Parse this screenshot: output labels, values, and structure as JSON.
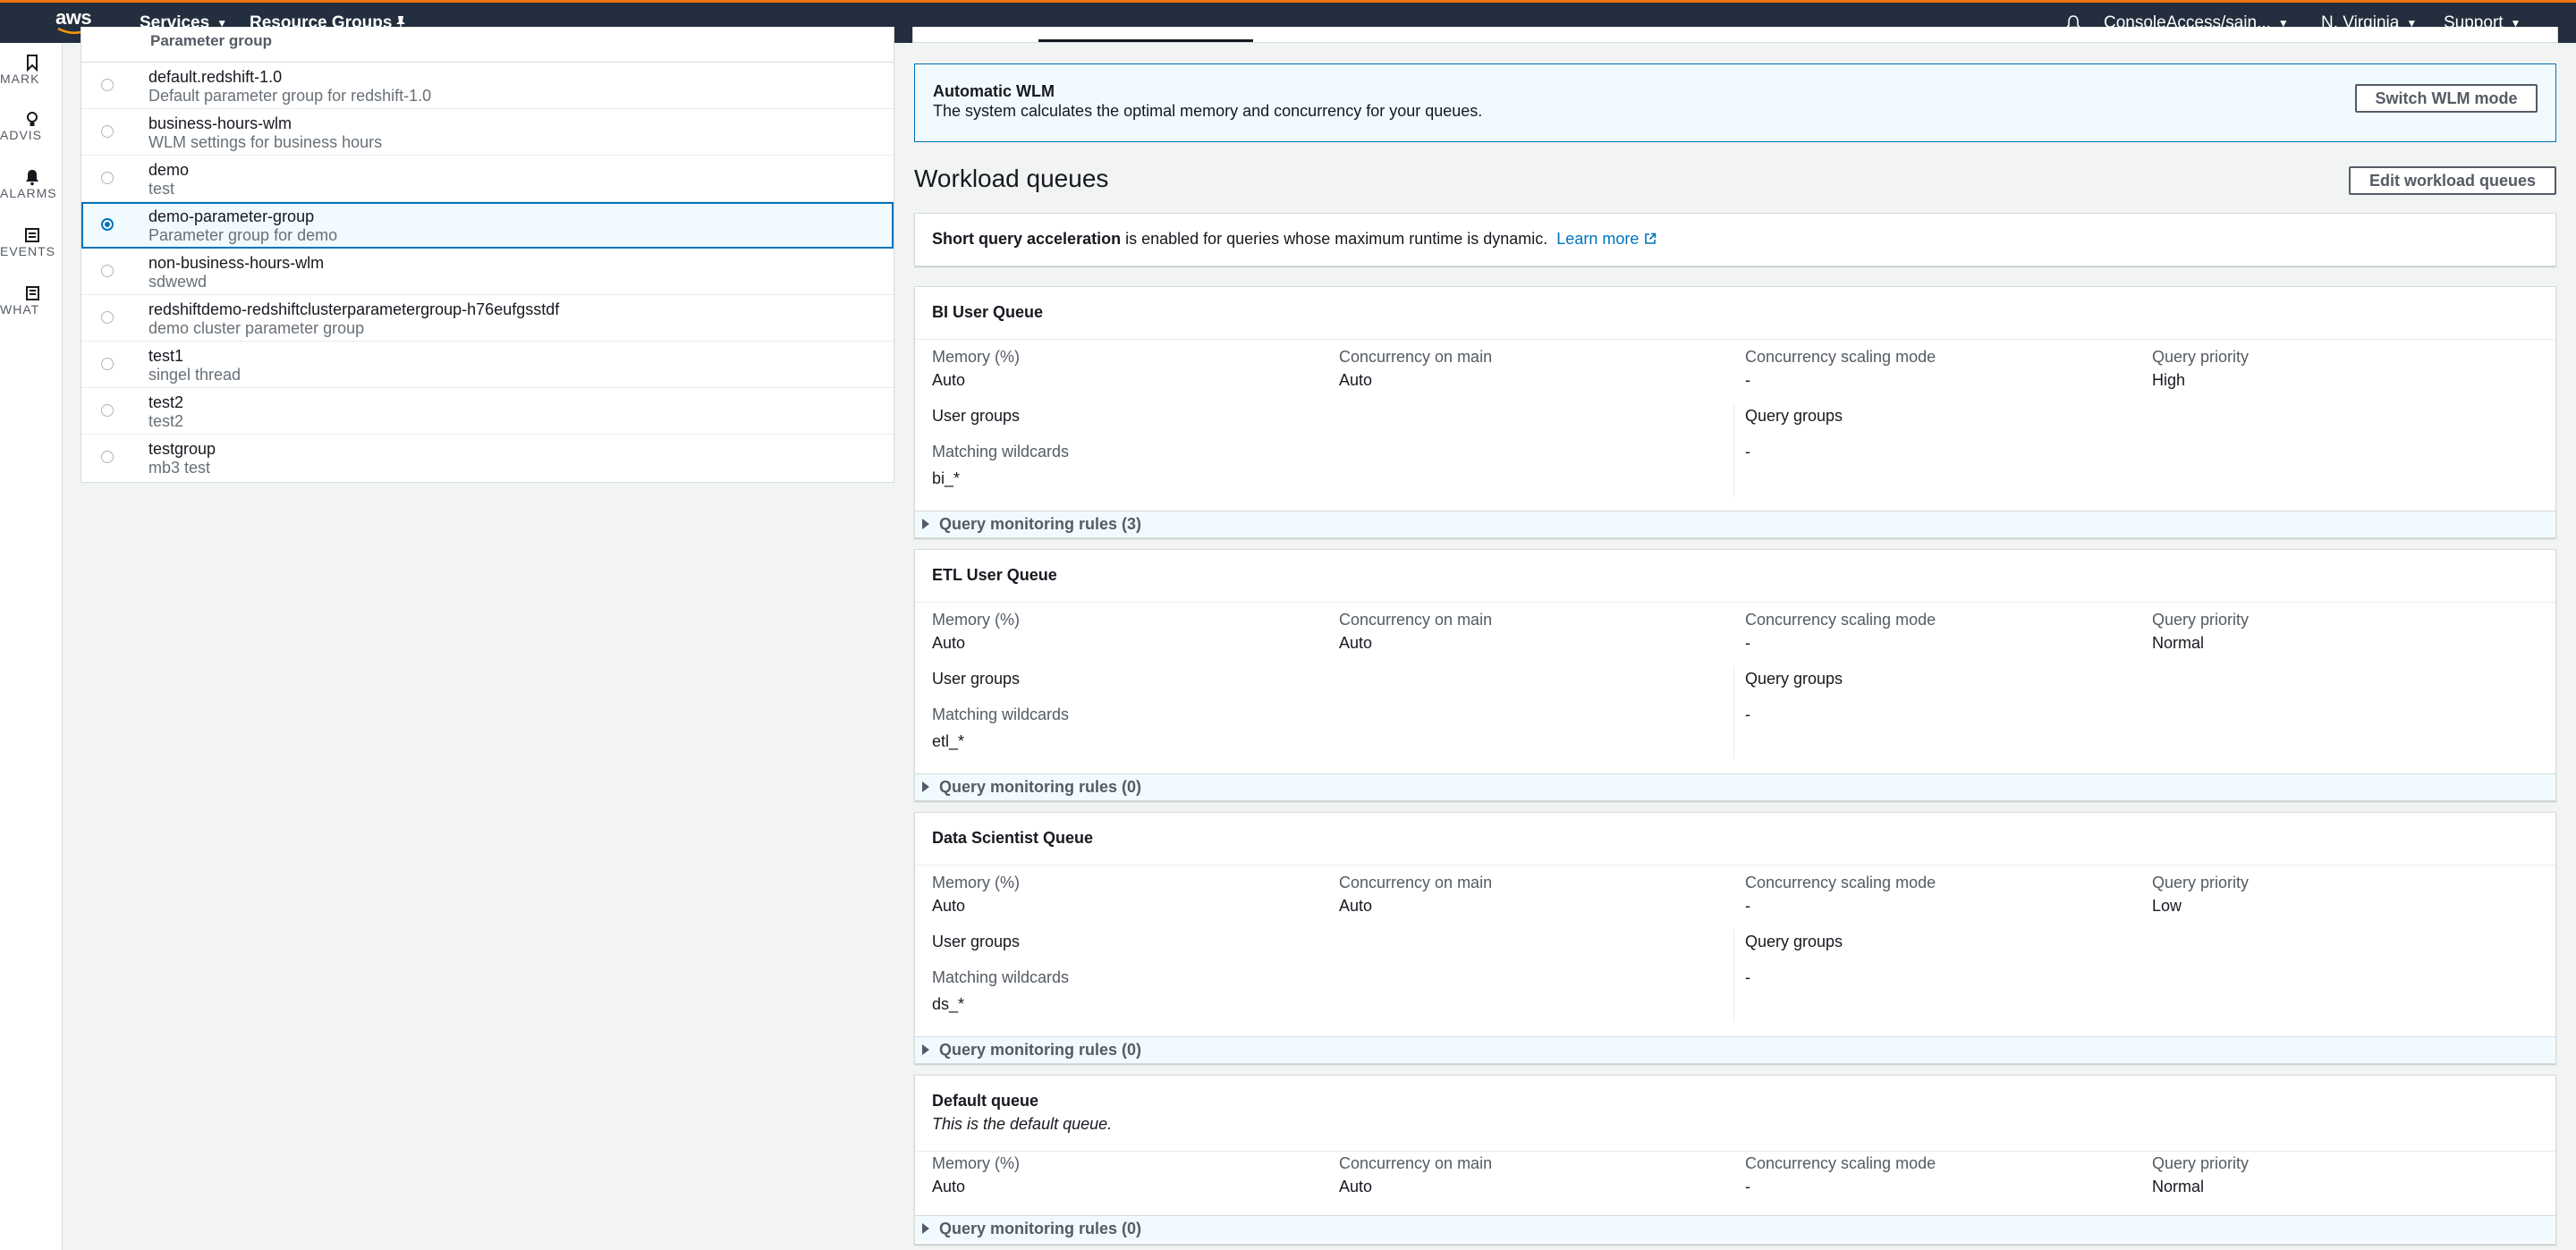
{
  "topnav": {
    "logo": "aws",
    "services_label": "Services",
    "resource_groups_label": "Resource Groups",
    "account_label": "ConsoleAccess/sain...",
    "region_label": "N. Virginia",
    "support_label": "Support",
    "icons": [
      "pin-icon",
      "bell-icon",
      "caret-down-icon"
    ]
  },
  "rail": {
    "items": [
      {
        "label": "MARK",
        "icon": "bookmark-icon"
      },
      {
        "label": "ADVIS",
        "icon": "lightbulb-icon"
      },
      {
        "label": "ALARMS",
        "icon": "bell-icon"
      },
      {
        "label": "EVENTS",
        "icon": "calendar-icon"
      },
      {
        "label": "WHAT",
        "icon": "document-icon"
      }
    ]
  },
  "parameter_groups": {
    "header": "Parameter group",
    "rows": [
      {
        "name": "default.redshift-1.0",
        "desc": "Default parameter group for redshift-1.0"
      },
      {
        "name": "business-hours-wlm",
        "desc": "WLM settings for business hours"
      },
      {
        "name": "demo",
        "desc": "test"
      },
      {
        "name": "demo-parameter-group",
        "desc": "Parameter group for demo"
      },
      {
        "name": "non-business-hours-wlm",
        "desc": "sdwewd"
      },
      {
        "name": "redshiftdemo-redshiftclusterparametergroup-h76eufgsstdf",
        "desc": "demo cluster parameter group"
      },
      {
        "name": "test1",
        "desc": "singel thread"
      },
      {
        "name": "test2",
        "desc": "test2"
      },
      {
        "name": "testgroup",
        "desc": "mb3 test"
      }
    ],
    "selected_index": 3
  },
  "wlm": {
    "title": "Automatic WLM",
    "desc": "The system calculates the optimal memory and concurrency for your queues.",
    "switch_label": "Switch WLM mode"
  },
  "workload": {
    "title": "Workload queues",
    "edit_label": "Edit workload queues",
    "sqa_bold": "Short query acceleration",
    "sqa_rest": " is enabled for queries whose maximum runtime is dynamic.",
    "learn_more": "Learn more"
  },
  "labels": {
    "memory": "Memory (%)",
    "concurrency": "Concurrency on main",
    "scaling": "Concurrency scaling mode",
    "priority": "Query priority",
    "user_groups": "User groups",
    "query_groups": "Query groups",
    "wildcards": "Matching wildcards"
  },
  "queues": [
    {
      "name": "BI User Queue",
      "memory": "Auto",
      "concurrency": "Auto",
      "scaling": "-",
      "priority": "High",
      "user_wildcard": "bi_*",
      "query_wildcard": "-",
      "rules": "Query monitoring rules (3)"
    },
    {
      "name": "ETL User Queue",
      "memory": "Auto",
      "concurrency": "Auto",
      "scaling": "-",
      "priority": "Normal",
      "user_wildcard": "etl_*",
      "query_wildcard": "-",
      "rules": "Query monitoring rules (0)"
    },
    {
      "name": "Data Scientist Queue",
      "memory": "Auto",
      "concurrency": "Auto",
      "scaling": "-",
      "priority": "Low",
      "user_wildcard": "ds_*",
      "query_wildcard": "-",
      "rules": "Query monitoring rules (0)"
    },
    {
      "name": "Default queue",
      "subtitle": "This is the default queue.",
      "memory": "Auto",
      "concurrency": "Auto",
      "scaling": "-",
      "priority": "Normal",
      "rules": "Query monitoring rules (0)"
    }
  ],
  "colors": {
    "nav_bg": "#232f3e",
    "accent": "#ec7211",
    "link": "#0073bb",
    "selected_bg": "#f1faff"
  }
}
